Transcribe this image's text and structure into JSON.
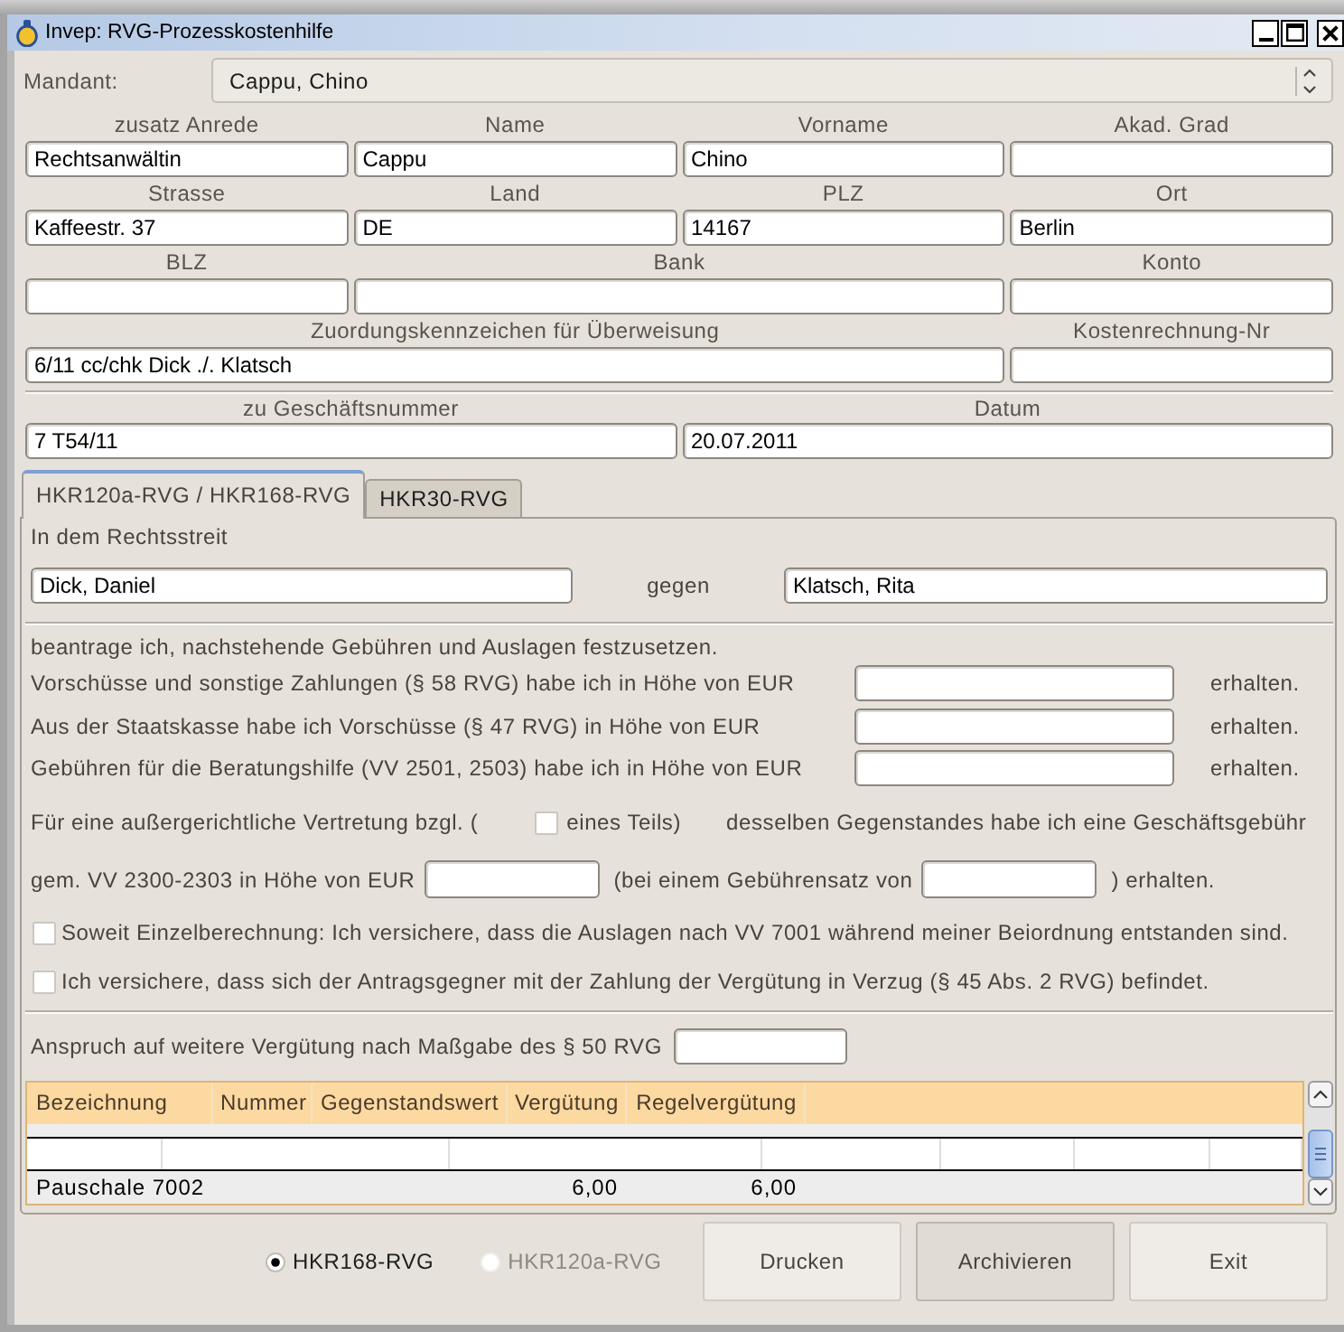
{
  "window": {
    "title": "Invep: RVG-Prozesskostenhilfe"
  },
  "client": {
    "label": "Mandant:",
    "value": "Cappu, Chino"
  },
  "address_rows": [
    [
      {
        "label": "zusatz Anrede",
        "value": "Rechtsanwältin"
      },
      {
        "label": "Name",
        "value": "Cappu"
      },
      {
        "label": "Vorname",
        "value": "Chino"
      },
      {
        "label": "Akad. Grad"
      }
    ],
    [
      {
        "label": "Strasse",
        "value": "Kaffeestr. 37"
      },
      {
        "label": "Land",
        "value": "DE"
      },
      {
        "label": "PLZ",
        "value": "14167"
      },
      {
        "label": "Ort",
        "value": "Berlin"
      }
    ],
    [
      {
        "label": "BLZ"
      },
      {
        "label": "Bank"
      },
      {
        "label": "Konto"
      }
    ],
    [
      {
        "label": "Zuordungskennzeichen für Überweisung",
        "value": "6/11 cc/chk Dick ./. Klatsch"
      },
      {
        "label": "Kostenrechnung-Nr"
      }
    ]
  ],
  "case_fields": [
    {
      "label": "zu Geschäftsnummer",
      "value": "7 T54/11"
    },
    {
      "label": "Datum",
      "value": "20.07.2011"
    }
  ],
  "tabs": [
    {
      "label": "HKR120a-RVG / HKR168-RVG",
      "selected": true
    },
    {
      "label": "HKR30-RVG",
      "selected": false
    }
  ],
  "lawsuit": {
    "heading": "In dem Rechtsstreit",
    "plaintiff": "Dick, Daniel",
    "versus": "gegen",
    "defendant": "Klatsch, Rita"
  },
  "application": {
    "intro": "beantrage ich, nachstehende Gebühren und Auslagen festzusetzen.",
    "payments": [
      {
        "label": "Vorschüsse und sonstige Zahlungen (§ 58 RVG) habe ich in Höhe von EUR",
        "suffix": "erhalten."
      },
      {
        "label": "Aus der Staatskasse habe ich Vorschüsse (§ 47 RVG) in Höhe von EUR",
        "suffix": "erhalten."
      },
      {
        "label": "Gebühren für die Beratungshilfe (VV 2501, 2503) habe ich in Höhe von EUR",
        "suffix": "erhalten."
      }
    ]
  },
  "business_fee": {
    "text_1": "Für eine außergerichtliche Vertretung bzgl. (",
    "partial": {
      "label": "eines Teils)",
      "checked": false
    },
    "text_2": "desselben Gegenstandes habe ich eine Geschäftsgebühr",
    "text_3": "gem. VV 2300-2303 in Höhe von EUR",
    "text_4": "(bei einem Gebührensatz von",
    "text_5": ") erhalten."
  },
  "declarations": [
    {
      "label": "Soweit Einzelberechnung: Ich versichere, dass die Auslagen nach VV 7001 während meiner Beiordnung entstanden sind.",
      "checked": false
    },
    {
      "label": "Ich versichere, dass sich der Antragsgegner mit der Zahlung der Vergütung in Verzug (§ 45 Abs. 2 RVG) befindet.",
      "checked": false
    }
  ],
  "further_claim": {
    "label": "Anspruch auf weitere Vergütung nach Maßgabe des § 50 RVG"
  },
  "table": {
    "columns": [
      "Bezeichnung",
      "Nummer",
      "Gegenstandswert",
      "Vergütung",
      "Regelvergütung"
    ],
    "rows": [
      {
        "kind": "blank"
      },
      {
        "kind": "item",
        "designation": "Pauschale 7002",
        "fee": "6,00",
        "standard_fee": "6,00"
      }
    ]
  },
  "form_variant": [
    {
      "label": "HKR168-RVG",
      "selected": true,
      "disabled": false
    },
    {
      "label": "HKR120a-RVG",
      "selected": false,
      "disabled": true
    }
  ],
  "buttons": [
    {
      "label": "Drucken",
      "hovered": false
    },
    {
      "label": "Archivieren",
      "hovered": true
    },
    {
      "label": "Exit",
      "hovered": false
    }
  ]
}
